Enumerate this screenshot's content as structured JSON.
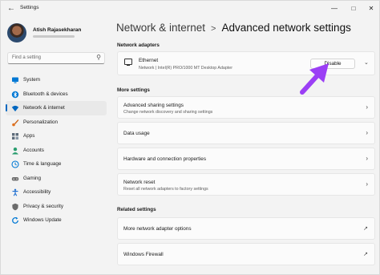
{
  "window": {
    "title": "Settings",
    "back_icon": "back-arrow-icon"
  },
  "user": {
    "name": "Atish Rajasekharan"
  },
  "search": {
    "placeholder": "Find a setting"
  },
  "sidebar": {
    "items": [
      {
        "label": "System",
        "icon": "monitor-icon",
        "color": "#0078d4"
      },
      {
        "label": "Bluetooth & devices",
        "icon": "bluetooth-icon",
        "color": "#0078d4"
      },
      {
        "label": "Network & internet",
        "icon": "wifi-icon",
        "color": "#0067c0",
        "active": true
      },
      {
        "label": "Personalization",
        "icon": "brush-icon",
        "color": "#e0721f"
      },
      {
        "label": "Apps",
        "icon": "apps-icon",
        "color": "#5d6b7a"
      },
      {
        "label": "Accounts",
        "icon": "person-icon",
        "color": "#2a9d6f"
      },
      {
        "label": "Time & language",
        "icon": "globe-clock-icon",
        "color": "#0078d4"
      },
      {
        "label": "Gaming",
        "icon": "gamepad-icon",
        "color": "#6b6b6b"
      },
      {
        "label": "Accessibility",
        "icon": "accessibility-icon",
        "color": "#1f6fd1"
      },
      {
        "label": "Privacy & security",
        "icon": "shield-icon",
        "color": "#6b6b6b"
      },
      {
        "label": "Windows Update",
        "icon": "update-icon",
        "color": "#0078d4"
      }
    ]
  },
  "breadcrumb": {
    "parent": "Network & internet",
    "separator": ">",
    "current": "Advanced network settings"
  },
  "network_adapters": {
    "heading": "Network adapters",
    "adapter": {
      "name": "Ethernet",
      "description": "Network | Intel(R) PRO/1000 MT Desktop Adapter",
      "button_label": "Disable"
    }
  },
  "more_settings": {
    "heading": "More settings",
    "items": [
      {
        "title": "Advanced sharing settings",
        "subtitle": "Change network discovery and sharing settings"
      },
      {
        "title": "Data usage",
        "subtitle": ""
      },
      {
        "title": "Hardware and connection properties",
        "subtitle": ""
      },
      {
        "title": "Network reset",
        "subtitle": "Reset all network adapters to factory settings"
      }
    ]
  },
  "related_settings": {
    "heading": "Related settings",
    "items": [
      {
        "title": "More network adapter options"
      },
      {
        "title": "Windows Firewall"
      }
    ]
  },
  "annotation": {
    "arrow_color": "#9b3ff5"
  }
}
